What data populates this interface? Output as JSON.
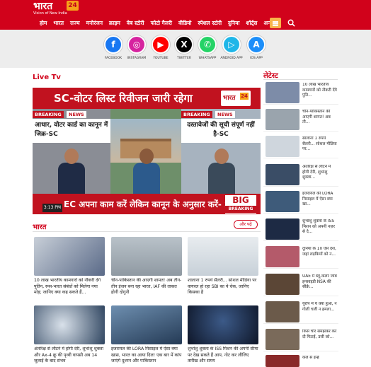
{
  "header": {
    "logo_text": "भारत",
    "logo_badge": "24",
    "logo_tagline": "Vision of New India",
    "nav": [
      "होम",
      "भारत",
      "राज्य",
      "मनोरंजन",
      "क्राइम",
      "वेब स्टोरी",
      "फोटो गैलरी",
      "वीडियो",
      "स्पेशल स्टोरी",
      "दुनिया",
      "शॉर्ट्स",
      "अन्य"
    ],
    "brand_color": "#d1021b"
  },
  "social": [
    {
      "label": "FACEBOOK",
      "icon": "facebook-icon",
      "glyph": "f",
      "color": "#1877f2"
    },
    {
      "label": "INSTAGRAM",
      "icon": "instagram-icon",
      "glyph": "◎",
      "color": "#d6249f"
    },
    {
      "label": "YOUTUBE",
      "icon": "youtube-icon",
      "glyph": "▶",
      "color": "#ff0000"
    },
    {
      "label": "TWITTER",
      "icon": "x-icon",
      "glyph": "X",
      "color": "#000000"
    },
    {
      "label": "WHATSAPP",
      "icon": "whatsapp-icon",
      "glyph": "✆",
      "color": "#25d366"
    },
    {
      "label": "ANDROID APP",
      "icon": "play-store-icon",
      "glyph": "▷",
      "color": "#1fb6e8"
    },
    {
      "label": "IOS APP",
      "icon": "app-store-icon",
      "glyph": "A",
      "color": "#1c8ef9"
    }
  ],
  "live_tv": {
    "title": "Live Tv",
    "headline_top": "SC-वोटर लिस्ट रिवीजन जारी रहेगा",
    "logo_text": "भारत",
    "logo_badge": "24",
    "breaking_label": "BREAKING",
    "news_label": "NEWS",
    "left_caption": "आधार, वोटर कार्ड का कानून में जिक्र-SC",
    "right_caption": "दस्तावेजों की सूची संपूर्ण नहीं है-SC",
    "bottom_headline": "EC अपना काम करें लेकिन कानून के अनुसार करें- SC",
    "time": "3:13 PM",
    "big_label": "BIG",
    "big_breaking_label": "BREAKING"
  },
  "bharat": {
    "title": "भारत",
    "more_label": "और पढ़ें",
    "cards": [
      {
        "title": "10 लाख भारतीय कामगारों को नौकरी देंगे पुतिन, रूस-भारत संबंधों को मिलेगा नया मोड़; जानिए क्या कह सकते हैं...",
        "img_color": "#7d8ca8"
      },
      {
        "title": "चीन-पाकिस्तान की आएगी शामत! अब तीन-तीन इंजन बना रहा भारत, IAF की ताकत होगी दोगुनी",
        "img_color": "#9aa4ad"
      },
      {
        "title": "शालाना 1 रुपये सैलरी... सोशल मीडिया पर वायरल हो रहा SBI का ये चेक, जानिए किसका है",
        "img_color": "#cfd6dd"
      },
      {
        "title": "अंतरिक्ष से लौटने में होगी देरी, शुभांशु शुक्ला और Ax-4 क्रू की पृथ्वी वापसी अब 14 जुलाई के बाद संभव",
        "img_color": "#3a4d66"
      },
      {
        "title": "इजरायल की LORA मिसाइल में ऐसा क्या खास, भारत का आया दिल! एक बार में कांप जाएंगे दुश्मन और पाकिस्तान",
        "img_color": "#3e5b7a"
      },
      {
        "title": "शुभांशु शुक्ला के ISS मिशन की अपनी सीमा पर देख सकते हैं आप, नोट कर लीजिए तारीख और समय",
        "img_color": "#1d2a44"
      }
    ]
  },
  "latest": {
    "title": "लेटेस्ट",
    "items": [
      {
        "title": "10 लाख भारतीय कामगारों को नौकरी देंगे पुति...",
        "img_color": "#7d8ca8"
      },
      {
        "title": "चीन-पाकिस्तान की आएगी शामत! अब ती...",
        "img_color": "#9aa4ad"
      },
      {
        "title": "सालाना 1 रुपये सैलरी... सोशल मीडिया पर...",
        "img_color": "#cfd6dd"
      },
      {
        "title": "अंतरिक्ष से लौटने में होगी देरी, शुभांशु शुक्ला...",
        "img_color": "#3a4d66"
      },
      {
        "title": "इजरायल की LORA मिसाइल में ऐसा क्या खा...",
        "img_color": "#3e5b7a"
      },
      {
        "title": "शुभांशु शुक्ला के ISS मिशन को अपनी नज़र से दे...",
        "img_color": "#1d2a44"
      },
      {
        "title": "दुनिया के 10 ऐसे देश, जहां लड़कियों को न...",
        "img_color": "#b45a6a"
      },
      {
        "title": "UAE में ब्लू-कलर जॉब इनसाइडी NSA की सीक्रे...",
        "img_color": "#5b4636"
      },
      {
        "title": "यूरोप में ये क्या हुआ, न गोली चली न हमला...",
        "img_color": "#6b5a4a"
      },
      {
        "title": "किसे चोर समझकर कर दी पिटाई, उसी को...",
        "img_color": "#7a6a5a"
      },
      {
        "title": "कल से इन्हें",
        "img_color": "#8a2a2a"
      }
    ]
  }
}
